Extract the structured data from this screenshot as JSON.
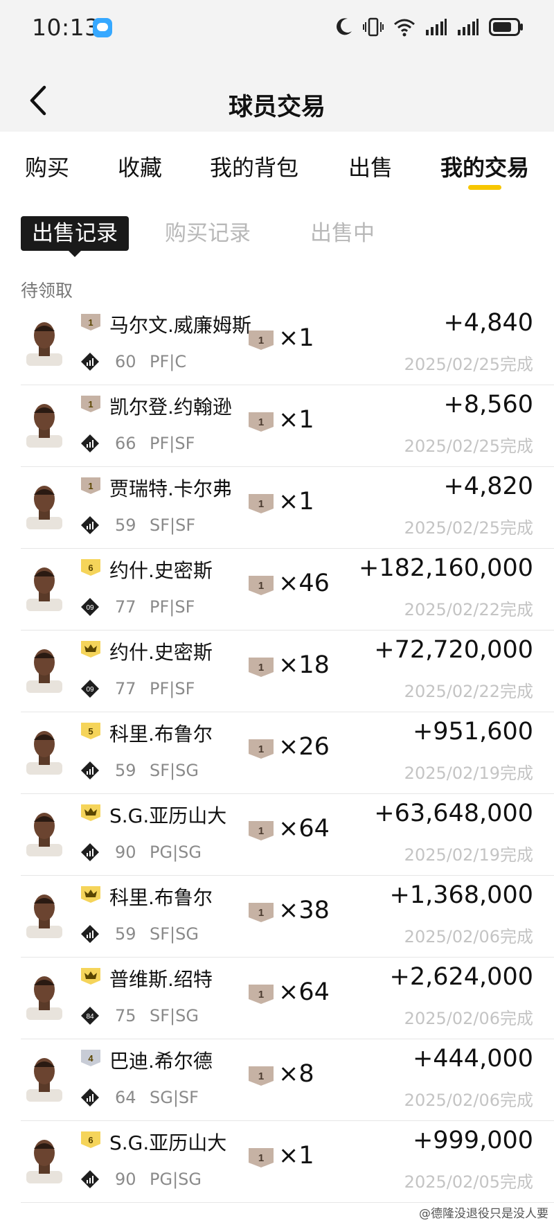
{
  "status_bar": {
    "time": "10:13"
  },
  "header": {
    "title": "球员交易",
    "back_icon": "chevron-left-icon"
  },
  "tabs": [
    {
      "label": "购买"
    },
    {
      "label": "收藏"
    },
    {
      "label": "我的背包"
    },
    {
      "label": "出售"
    },
    {
      "label": "我的交易",
      "active": true
    }
  ],
  "subtabs": [
    {
      "label": "出售记录",
      "active": true
    },
    {
      "label": "购买记录"
    },
    {
      "label": "出售中"
    }
  ],
  "section_label": "待领取",
  "colors": {
    "accent": "#f7c600",
    "gold_badge": "#f5d45a",
    "bronze_badge": "#c6b2a4",
    "silver_badge": "#c8ccd6"
  },
  "rows": [
    {
      "badge": "1",
      "badge_type": "bronze",
      "name": "马尔文.威廉姆斯",
      "diamond": "",
      "rating": "60",
      "pos": "PF|C",
      "qty_badge": "1",
      "qty": "×1",
      "price": "+4,840",
      "date": "2025/02/25完成"
    },
    {
      "badge": "1",
      "badge_type": "bronze",
      "name": "凯尔登.约翰逊",
      "diamond": "",
      "rating": "66",
      "pos": "PF|SF",
      "qty_badge": "1",
      "qty": "×1",
      "price": "+8,560",
      "date": "2025/02/25完成"
    },
    {
      "badge": "1",
      "badge_type": "bronze",
      "name": "贾瑞特.卡尔弗",
      "diamond": "",
      "rating": "59",
      "pos": "SF|SF",
      "qty_badge": "1",
      "qty": "×1",
      "price": "+4,820",
      "date": "2025/02/25完成"
    },
    {
      "badge": "6",
      "badge_type": "gold",
      "name": "约什.史密斯",
      "diamond": "09",
      "rating": "77",
      "pos": "PF|SF",
      "qty_badge": "1",
      "qty": "×46",
      "price": "+182,160,000",
      "date": "2025/02/22完成"
    },
    {
      "badge": "crown",
      "badge_type": "crown",
      "name": "约什.史密斯",
      "diamond": "09",
      "rating": "77",
      "pos": "PF|SF",
      "qty_badge": "1",
      "qty": "×18",
      "price": "+72,720,000",
      "date": "2025/02/22完成"
    },
    {
      "badge": "5",
      "badge_type": "gold",
      "name": "科里.布鲁尔",
      "diamond": "",
      "rating": "59",
      "pos": "SF|SG",
      "qty_badge": "1",
      "qty": "×26",
      "price": "+951,600",
      "date": "2025/02/19完成"
    },
    {
      "badge": "crown",
      "badge_type": "crown",
      "name": "S.G.亚历山大",
      "diamond": "",
      "rating": "90",
      "pos": "PG|SG",
      "qty_badge": "1",
      "qty": "×64",
      "price": "+63,648,000",
      "date": "2025/02/19完成"
    },
    {
      "badge": "crown",
      "badge_type": "crown",
      "name": "科里.布鲁尔",
      "diamond": "",
      "rating": "59",
      "pos": "SF|SG",
      "qty_badge": "1",
      "qty": "×38",
      "price": "+1,368,000",
      "date": "2025/02/06完成"
    },
    {
      "badge": "crown",
      "badge_type": "crown",
      "name": "普维斯.绍特",
      "diamond": "84",
      "rating": "75",
      "pos": "SF|SG",
      "qty_badge": "1",
      "qty": "×64",
      "price": "+2,624,000",
      "date": "2025/02/06完成"
    },
    {
      "badge": "4",
      "badge_type": "silver",
      "name": "巴迪.希尔德",
      "diamond": "",
      "rating": "64",
      "pos": "SG|SF",
      "qty_badge": "1",
      "qty": "×8",
      "price": "+444,000",
      "date": "2025/02/06完成"
    },
    {
      "badge": "6",
      "badge_type": "gold",
      "name": "S.G.亚历山大",
      "diamond": "",
      "rating": "90",
      "pos": "PG|SG",
      "qty_badge": "1",
      "qty": "×1",
      "price": "+999,000",
      "date": "2025/02/05完成"
    }
  ],
  "watermark": "@德隆没退役只是没人要"
}
